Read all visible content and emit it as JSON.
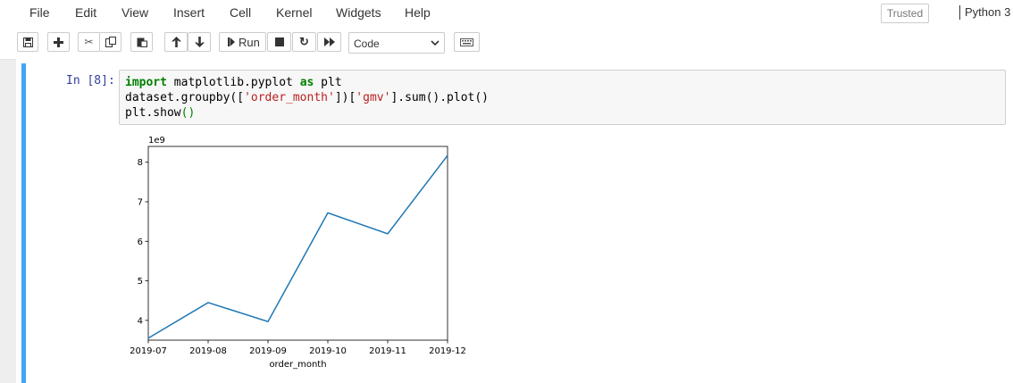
{
  "menubar": {
    "items": [
      "File",
      "Edit",
      "View",
      "Insert",
      "Cell",
      "Kernel",
      "Widgets",
      "Help"
    ],
    "trusted_label": "Trusted",
    "kernel_name": "Python 3"
  },
  "toolbar": {
    "run_label": "Run",
    "cell_type": "Code"
  },
  "cell": {
    "prompt": "In [8]:",
    "code_line1_kw1": "import",
    "code_line1_mid": " matplotlib.pyplot ",
    "code_line1_kw2": "as",
    "code_line1_end": " plt",
    "code_line2_a": "dataset.groupby([",
    "code_line2_str1": "'order_month'",
    "code_line2_b": "])[",
    "code_line2_str2": "'gmv'",
    "code_line2_c": "].sum().plot()",
    "code_line3_a": "plt.show",
    "code_line3_paren": "()"
  },
  "chart_data": {
    "type": "line",
    "categories": [
      "2019-07",
      "2019-08",
      "2019-09",
      "2019-10",
      "2019-11",
      "2019-12"
    ],
    "series": [
      {
        "values": [
          3.55,
          4.45,
          3.97,
          6.72,
          6.19,
          8.17
        ],
        "color": "#1f77b4"
      }
    ],
    "title": "",
    "xlabel": "order_month",
    "ylabel": "",
    "y_offset_label": "1e9",
    "yticks": [
      4,
      5,
      6,
      7,
      8
    ],
    "ylim": [
      3.5,
      8.4
    ],
    "grid": false
  }
}
